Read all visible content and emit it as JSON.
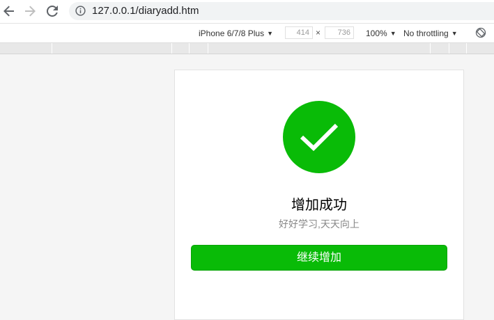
{
  "browser": {
    "url": "127.0.0.1/diaryadd.htm"
  },
  "device_toolbar": {
    "device": "iPhone 6/7/8 Plus",
    "width": "414",
    "separator": "×",
    "height": "736",
    "zoom": "100%",
    "throttling": "No throttling",
    "caret": "▼"
  },
  "page": {
    "title": "增加成功",
    "description": "好好学习,天天向上",
    "button_label": "继续增加",
    "accent_color": "#09bb07"
  },
  "icons": {
    "back": "arrow-left-icon",
    "forward": "arrow-right-icon",
    "reload": "reload-icon",
    "info": "info-icon",
    "rotate": "rotate-icon",
    "success": "checkmark-icon"
  }
}
